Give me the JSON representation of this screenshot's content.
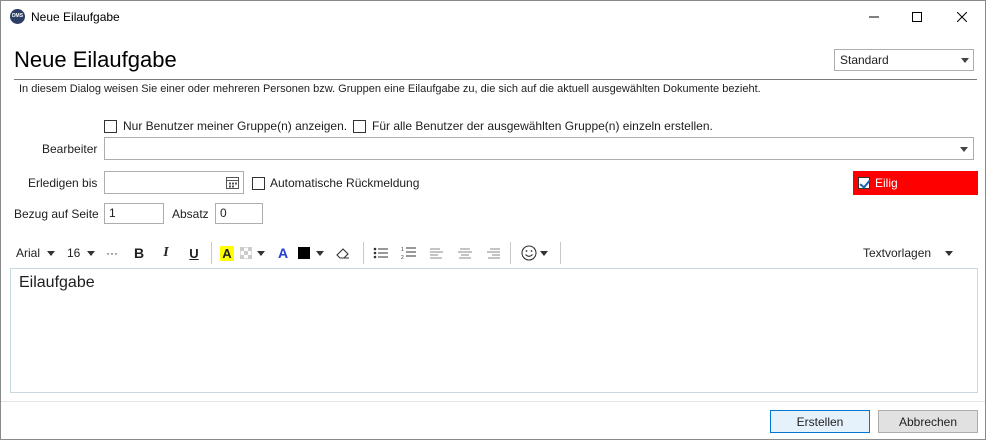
{
  "window": {
    "title": "Neue Eilaufgabe",
    "app_icon_text": "DMS"
  },
  "header": {
    "heading": "Neue Eilaufgabe",
    "profile_select": "Standard",
    "description": "In diesem Dialog weisen Sie einer oder mehreren Personen bzw. Gruppen eine Eilaufgabe zu, die sich auf die aktuell ausgewählten Dokumente bezieht."
  },
  "form": {
    "only_my_groups_label": "Nur Benutzer meiner Gruppe(n) anzeigen.",
    "each_user_label": "Für alle Benutzer der ausgewählten Gruppe(n) einzeln erstellen.",
    "editor_label": "Bearbeiter",
    "editor_value": "",
    "due_label": "Erledigen bis",
    "due_value": "",
    "auto_feedback_label": "Automatische Rückmeldung",
    "urgent_label": "Eilig",
    "urgent_checked": true,
    "page_ref_label": "Bezug auf Seite",
    "page_ref_value": "1",
    "paragraph_label": "Absatz",
    "paragraph_value": "0"
  },
  "toolbar": {
    "font": "Arial",
    "size": "16",
    "more": "···",
    "bold": "B",
    "italic": "I",
    "underline": "U",
    "highlight": "A",
    "font_color": "A",
    "templates": "Textvorlagen"
  },
  "editor_body": {
    "text": "Eilaufgabe"
  },
  "footer": {
    "create_label": "Erstellen",
    "cancel_label": "Abbrechen"
  },
  "colors": {
    "urgent_bg": "#ff0000",
    "accent": "#0078d7",
    "highlight_yellow": "#ffff00",
    "font_color_blue": "#1f3fd6"
  }
}
